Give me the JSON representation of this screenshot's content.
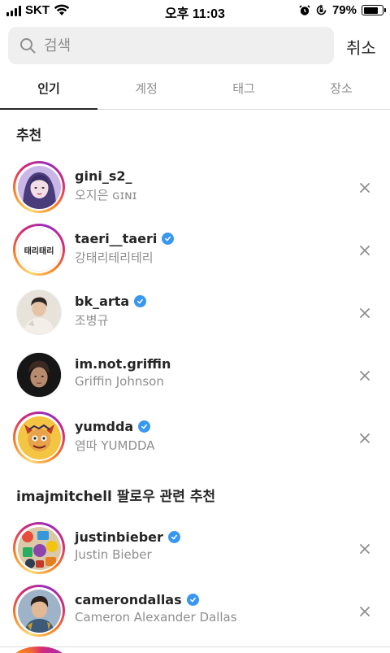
{
  "status_bar": {
    "carrier": "SKT",
    "time": "오후 11:03",
    "battery": "79%",
    "battery_level": 0.79
  },
  "search": {
    "placeholder": "검색",
    "cancel_label": "취소"
  },
  "tabs": [
    {
      "label": "인기",
      "active": true
    },
    {
      "label": "계정",
      "active": false
    },
    {
      "label": "태그",
      "active": false
    },
    {
      "label": "장소",
      "active": false
    }
  ],
  "suggested": {
    "title": "추천",
    "users": [
      {
        "username": "gini_s2_",
        "full_name": "오지은 ɢɪɴɪ",
        "verified": false,
        "story_ring": true
      },
      {
        "username": "taeri__taeri",
        "full_name": "강태리테리테리",
        "verified": true,
        "story_ring": true,
        "avatar_text": "태리태리"
      },
      {
        "username": "bk_arta",
        "full_name": "조병규",
        "verified": true,
        "story_ring": false
      },
      {
        "username": "im.not.griffin",
        "full_name": "Griffin Johnson",
        "verified": false,
        "story_ring": false
      },
      {
        "username": "yumdda",
        "full_name": "염따 YUMDDA",
        "verified": true,
        "story_ring": true
      }
    ]
  },
  "related": {
    "title": "imajmitchell 팔로우 관련 추천",
    "users": [
      {
        "username": "justinbieber",
        "full_name": "Justin Bieber",
        "verified": true,
        "story_ring": true
      },
      {
        "username": "camerondallas",
        "full_name": "Cameron Alexander Dallas",
        "verified": true,
        "story_ring": true
      }
    ]
  },
  "colors": {
    "verified": "#3897f0",
    "secondary_text": "#8e8e8e",
    "primary_text": "#262626"
  }
}
